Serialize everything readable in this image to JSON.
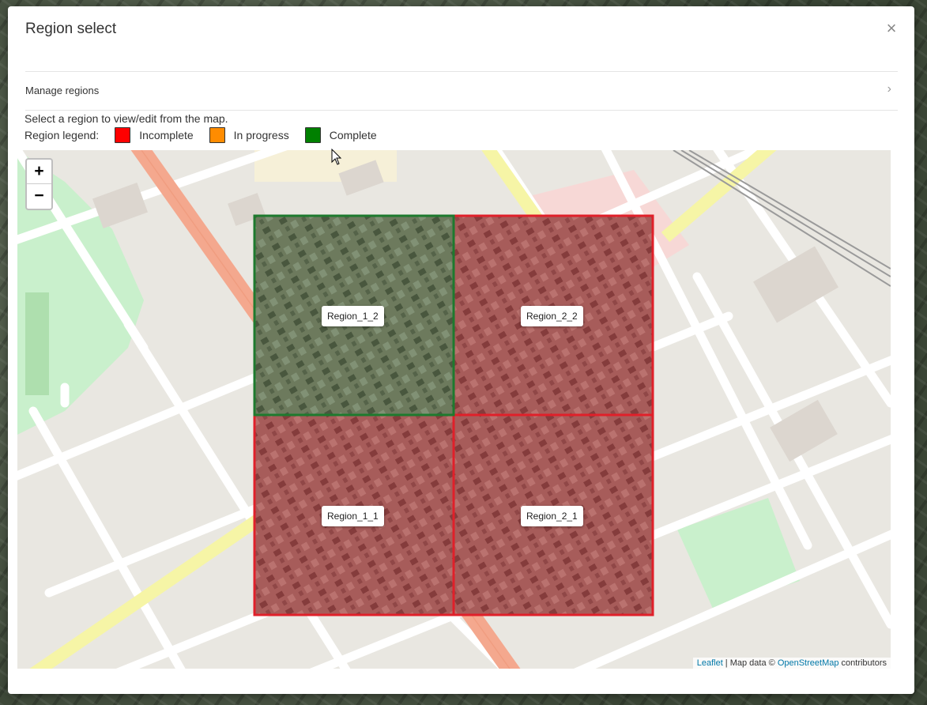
{
  "modal": {
    "title": "Region select",
    "close_glyph": "×"
  },
  "manage": {
    "label": "Manage regions",
    "chevron": "›"
  },
  "instructions": "Select a region to view/edit from the map.",
  "legend": {
    "label": "Region legend:",
    "items": [
      {
        "label": "Incomplete",
        "color": "#ff0000"
      },
      {
        "label": "In progress",
        "color": "#ff8c00"
      },
      {
        "label": "Complete",
        "color": "#008000"
      }
    ]
  },
  "map": {
    "zoom_in": "+",
    "zoom_out": "−",
    "regions": [
      {
        "name": "Region_1_2",
        "status": "Complete",
        "color": "#1e7a2e"
      },
      {
        "name": "Region_2_2",
        "status": "Incomplete",
        "color": "#e0202a"
      },
      {
        "name": "Region_1_1",
        "status": "Incomplete",
        "color": "#e0202a"
      },
      {
        "name": "Region_2_1",
        "status": "Incomplete",
        "color": "#e0202a"
      }
    ],
    "attribution": {
      "leaflet": "Leaflet",
      "separator": " | Map data © ",
      "osm": "OpenStreetMap",
      "suffix": " contributors"
    }
  }
}
